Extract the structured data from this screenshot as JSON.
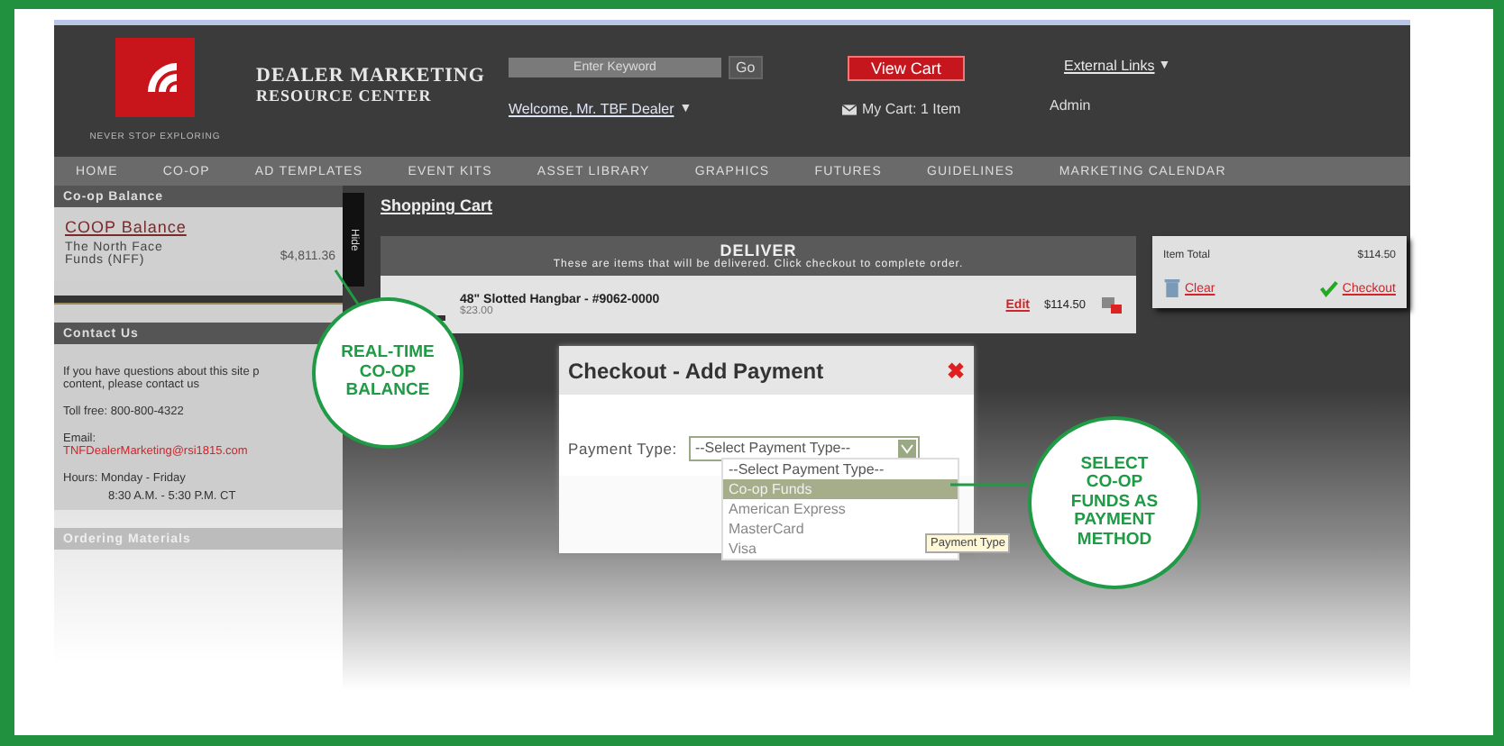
{
  "header": {
    "logo_tagline": "NEVER STOP EXPLORING",
    "site_title": [
      "DEALER MARKETING",
      "RESOURCE CENTER"
    ],
    "search": {
      "placeholder": "Enter Keyword"
    },
    "go_button": "Go",
    "welcome": "Welcome, Mr. TBF Dealer",
    "welcome_caret": "▼",
    "view_cart": "View Cart",
    "my_cart": "My Cart: 1 Item",
    "external_links": "External Links",
    "external_caret": "▼",
    "admin": "Admin"
  },
  "nav": [
    "HOME",
    "CO-OP",
    "AD TEMPLATES",
    "EVENT KITS",
    "ASSET LIBRARY",
    "GRAPHICS",
    "FUTURES",
    "GUIDELINES",
    "MARKETING CALENDAR"
  ],
  "sidebar": {
    "balance_header": "Co-op Balance",
    "balance_link": "COOP Balance",
    "fund_name": "The North Face Funds (NFF)",
    "fund_amount": "$4,811.36",
    "hide_tab": "Hide",
    "contact_header": "Contact Us",
    "contact_lines": [
      "If you have questions about this site p",
      "content, please contact us"
    ],
    "toll_free": "Toll free: 800-800-4322",
    "email_label": "Email:",
    "email": "TNFDealerMarketing@rsi1815.com",
    "hours": "Hours: Monday - Friday",
    "hours_time": "8:30 A.M. - 5:30 P.M. CT",
    "ordering_header": "Ordering Materials"
  },
  "cart": {
    "title": "Shopping Cart",
    "section": "DELIVER",
    "section_note": "These are items that will be delivered. Click checkout to complete order.",
    "items": [
      {
        "name": "48\" Slotted Hangbar - #9062-0000",
        "unit_price": "$23.00",
        "edit": "Edit",
        "total": "$114.50"
      }
    ],
    "item_total_label": "Item Total",
    "item_total": "$114.50",
    "clear": "Clear",
    "checkout": "Checkout"
  },
  "dialog": {
    "title": "Checkout - Add Payment",
    "close": "✖",
    "field_label": "Payment Type:",
    "value": "--Select Payment Type--",
    "options": [
      {
        "label": "--Select Payment Type--",
        "highlighted": false
      },
      {
        "label": "Co-op Funds",
        "highlighted": true
      },
      {
        "label": "American Express",
        "highlighted": false
      },
      {
        "label": "MasterCard",
        "highlighted": false
      },
      {
        "label": "Visa",
        "highlighted": false
      }
    ],
    "tooltip": "Payment Type"
  },
  "callouts": [
    "REAL-TIME CO-OP BALANCE",
    "SELECT CO-OP FUNDS AS PAYMENT METHOD"
  ]
}
